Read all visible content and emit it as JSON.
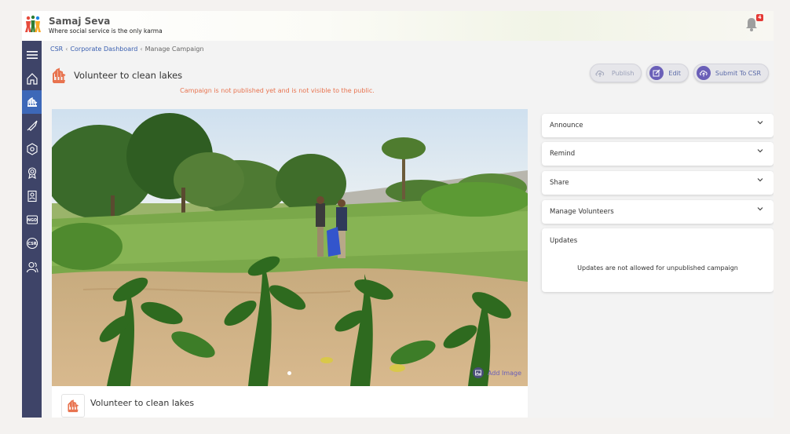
{
  "app": {
    "title": "Samaj Seva",
    "tagline": "Where social service is the only karma",
    "notification_count": "4"
  },
  "sidebar": {
    "items": [
      {
        "icon": "menu-icon",
        "active": false
      },
      {
        "icon": "home-icon",
        "active": false
      },
      {
        "icon": "volunteer-hands-icon",
        "active": true
      },
      {
        "icon": "rocket-icon",
        "active": false
      },
      {
        "icon": "gear-hex-icon",
        "active": false
      },
      {
        "icon": "badge-icon",
        "active": false
      },
      {
        "icon": "id-card-icon",
        "active": false
      },
      {
        "icon": "ngo-icon",
        "active": false,
        "label": "NGO"
      },
      {
        "icon": "csr-icon",
        "active": false,
        "label": "CSR"
      },
      {
        "icon": "users-icon",
        "active": false
      }
    ]
  },
  "breadcrumb": {
    "items": [
      "CSR",
      "Corporate Dashboard",
      "Manage Campaign"
    ]
  },
  "page": {
    "title": "Volunteer to clean lakes",
    "warning": "Campaign is not published yet and is not visible to the public."
  },
  "actions": {
    "publish": "Publish",
    "edit": "Edit",
    "submit": "Submit To CSR"
  },
  "hero": {
    "add_image_label": "Add Image"
  },
  "campaign_card": {
    "title": "Volunteer to clean lakes"
  },
  "panels": {
    "announce": "Announce",
    "remind": "Remind",
    "share": "Share",
    "manage_volunteers": "Manage Volunteers",
    "updates": "Updates",
    "updates_message": "Updates are not allowed for unpublished campaign"
  },
  "colors": {
    "sidebar": "#3e4468",
    "sidebar_active": "#3d68b8",
    "accent": "#6a5fb8",
    "warning": "#e8734f",
    "brand_orange": "#e8734f"
  }
}
